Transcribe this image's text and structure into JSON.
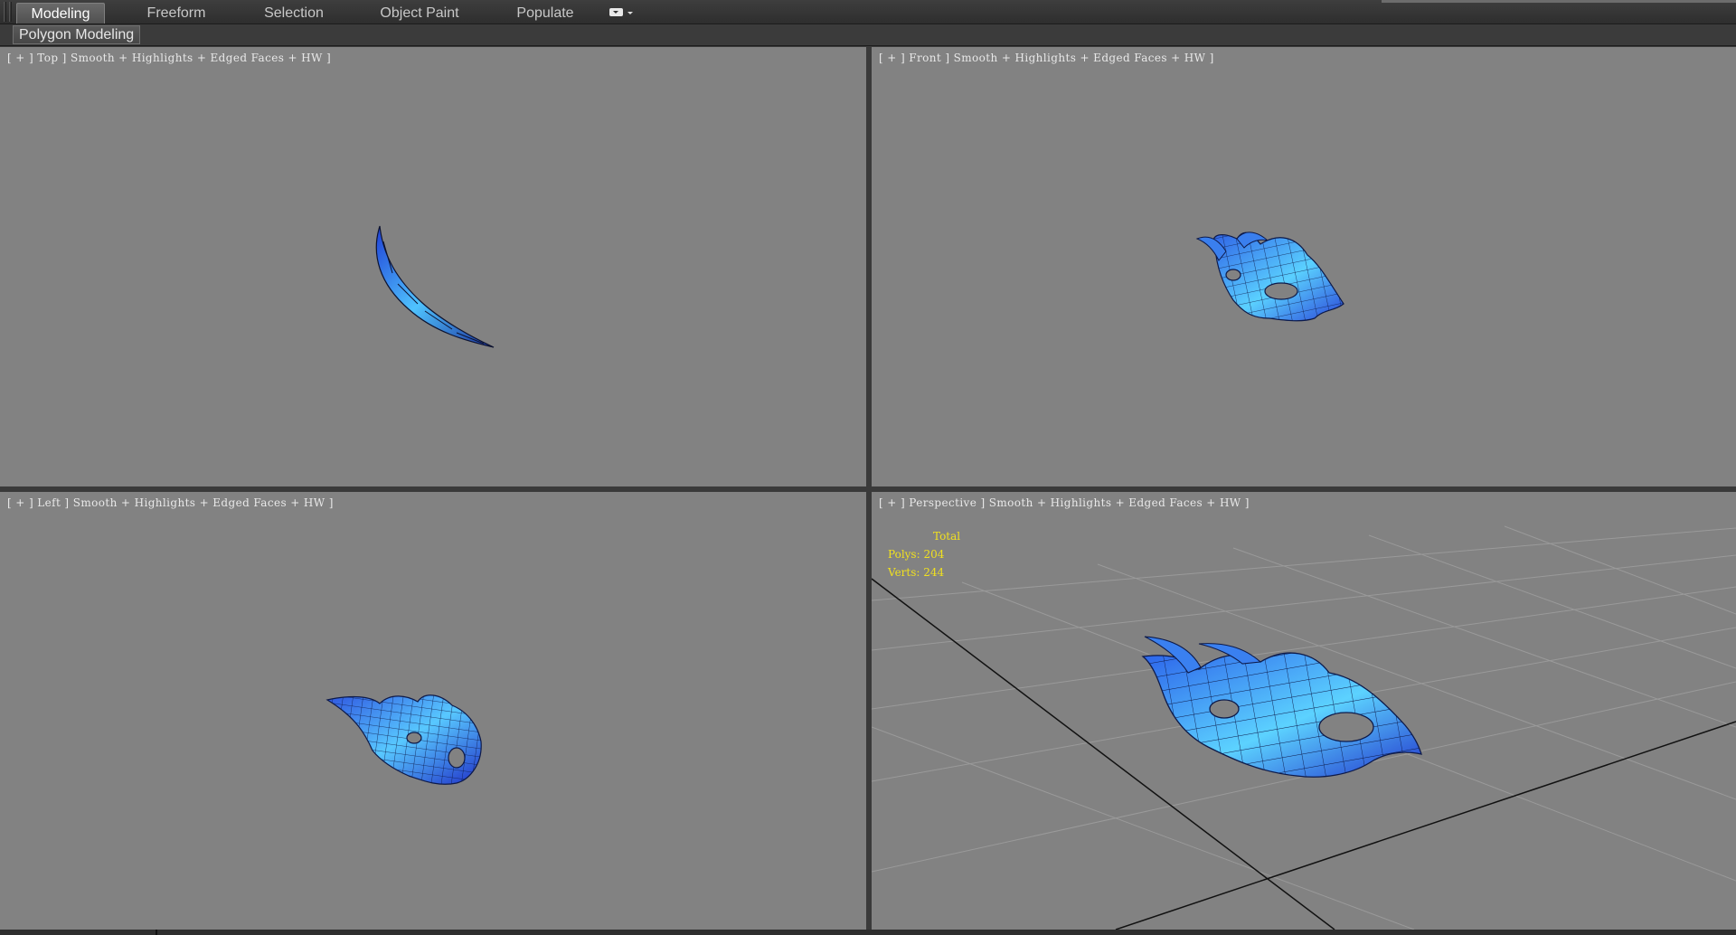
{
  "ribbon": {
    "tabs": [
      {
        "label": "Modeling",
        "active": true
      },
      {
        "label": "Freeform",
        "active": false
      },
      {
        "label": "Selection",
        "active": false
      },
      {
        "label": "Object Paint",
        "active": false
      },
      {
        "label": "Populate",
        "active": false
      }
    ],
    "dropdown_icon": "ribbon-options-icon",
    "panel_label": "Polygon Modeling"
  },
  "viewports": {
    "top": {
      "label": "[ + ] Top ] Smooth + Highlights + Edged Faces + HW ]"
    },
    "front": {
      "label": "[ + ] Front ] Smooth + Highlights + Edged Faces + HW ]"
    },
    "left": {
      "label": "[ + ] Left ] Smooth + Highlights + Edged Faces + HW ]"
    },
    "perspective": {
      "label": "[ + ] Perspective ] Smooth + Highlights + Edged Faces + HW ]"
    }
  },
  "stats": {
    "title": "Total",
    "polys": "Polys: 204",
    "verts": "Verts: 244"
  },
  "colors": {
    "viewport_bg": "#828282",
    "mesh_light": "#4fc3ff",
    "mesh_dark": "#1f3fd6",
    "stats_text": "#f0e020"
  }
}
